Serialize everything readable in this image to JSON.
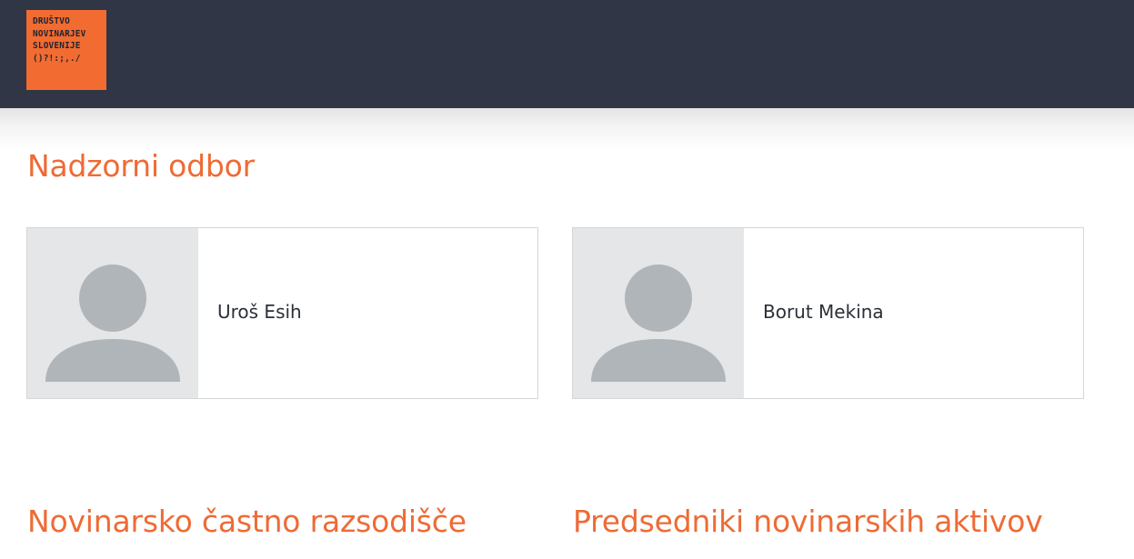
{
  "header": {
    "logo_lines": [
      "DRUŠTVO",
      "NOVINARJEV",
      "SLOVENIJE",
      "()?!:;,./"
    ],
    "brand_color": "#f26b30",
    "bar_color": "#303645"
  },
  "sections": [
    {
      "title": "Nadzorni odbor",
      "members": [
        {
          "name": "Uroš Esih",
          "photo": "avatar-placeholder-icon"
        },
        {
          "name": "Borut Mekina",
          "photo": "avatar-placeholder-icon"
        }
      ]
    },
    {
      "title": "Novinarsko častno razsodišče"
    },
    {
      "title": "Predsedniki novinarskih aktivov"
    }
  ],
  "accent_color": "#ee6b35"
}
